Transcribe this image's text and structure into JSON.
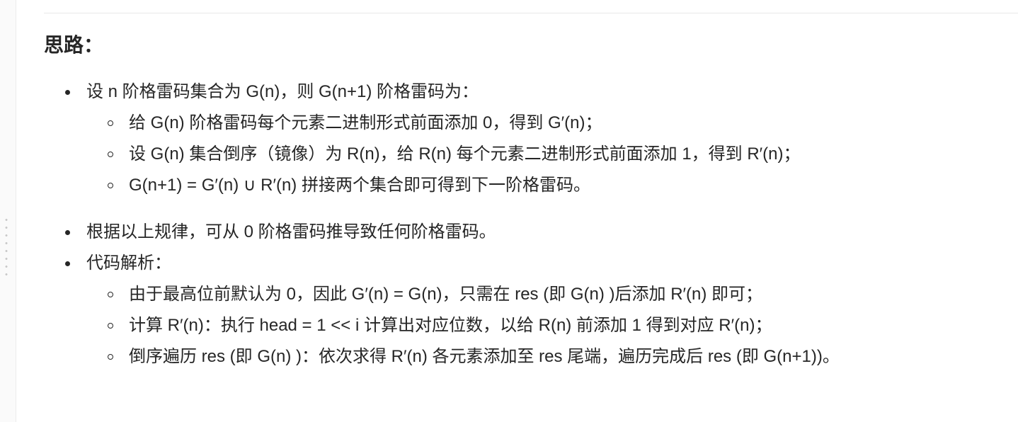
{
  "heading": "思路：",
  "items": [
    {
      "label": "设 n 阶格雷码集合为 G(n)，则 G(n+1) 阶格雷码为：",
      "children": [
        "给 G(n) 阶格雷码每个元素二进制形式前面添加 0，得到 G′(n)；",
        "设 G(n) 集合倒序（镜像）为 R(n)，给 R(n) 每个元素二进制形式前面添加 1，得到 R′(n)；",
        "G(n+1) = G′(n) ∪ R′(n) 拼接两个集合即可得到下一阶格雷码。"
      ]
    },
    {
      "label": "根据以上规律，可从 0 阶格雷码推导致任何阶格雷码。"
    },
    {
      "label": "代码解析：",
      "children": [
        "由于最高位前默认为 0，因此 G′(n) = G(n)，只需在 res (即 G(n) )后添加 R′(n) 即可；",
        "计算 R′(n)：执行 head = 1 << i 计算出对应位数，以给 R(n) 前添加 1 得到对应 R′(n)；",
        "倒序遍历 res (即 G(n) )：依次求得 R′(n) 各元素添加至 res 尾端，遍历完成后 res (即 G(n+1))。"
      ]
    }
  ]
}
